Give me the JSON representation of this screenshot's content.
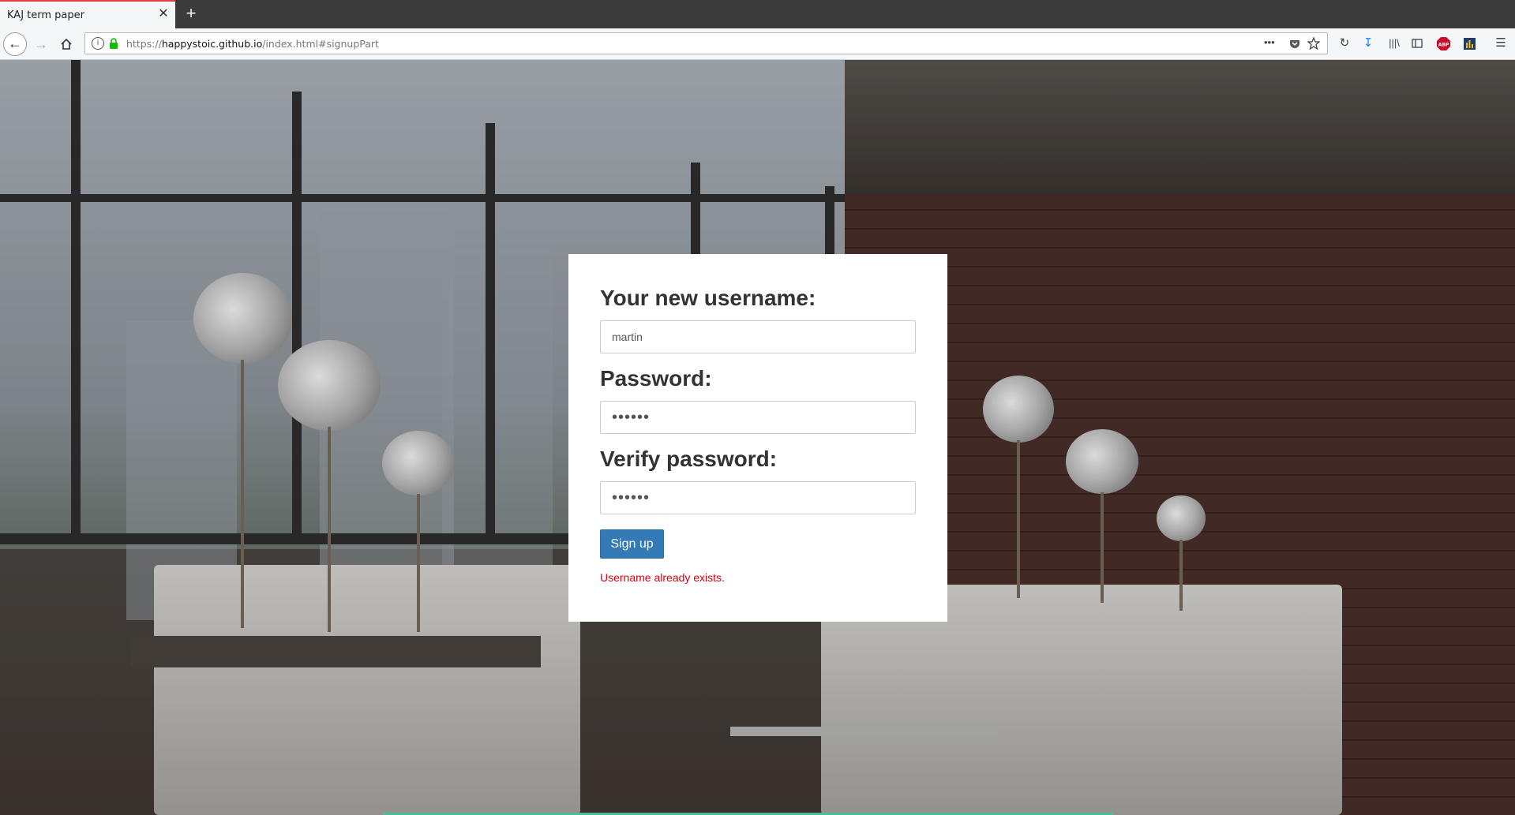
{
  "browser": {
    "tab_title": "KAJ term paper",
    "tab_close": "✕",
    "new_tab": "+",
    "url_scheme": "https://",
    "url_host": "happystoic.github.io",
    "url_path": "/index.html#signupPart",
    "page_actions": "•••"
  },
  "signup": {
    "username_label": "Your new username:",
    "username_value": "martin",
    "password_label": "Password:",
    "password_value": "••••••",
    "verify_label": "Verify password:",
    "verify_value": "••••••",
    "submit_label": "Sign up",
    "error_message": "Username already exists."
  },
  "colors": {
    "accent": "#337ab7",
    "error": "#d9000c",
    "tab_accent": "#e0413b",
    "bottom_line": "#4ebb9c"
  }
}
